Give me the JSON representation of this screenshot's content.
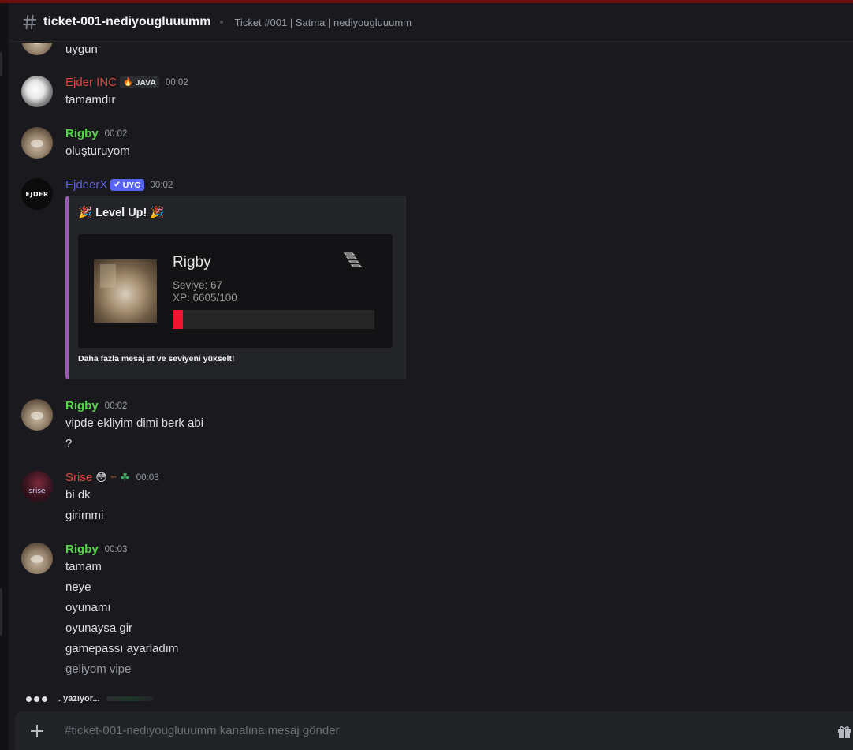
{
  "header": {
    "channel_name": "ticket-001-nediyougluuumm",
    "topic": "Ticket #001 | Satma | nediyougluuumm"
  },
  "messages": [
    {
      "lines": [
        "uygun"
      ]
    },
    {
      "author": "Ejder INC",
      "author_color": "#e0453a",
      "tag": "JAVA",
      "time": "00:02",
      "lines": [
        "tamamdır"
      ]
    },
    {
      "author": "Rigby",
      "author_color": "#55d648",
      "time": "00:02",
      "lines": [
        "oluşturuyom"
      ]
    },
    {
      "author": "EjdeerX",
      "author_color": "#5b63d6",
      "tag": "UYG",
      "avatar_text": "EJDER",
      "time": "00:02",
      "embed": {
        "title": "🎉 Level Up! 🎉",
        "card": {
          "name": "Rigby",
          "level": "Seviye: 67",
          "xp": "XP: 6605/100",
          "progress_fraction": 0.05
        },
        "footer": "Daha fazla mesaj at ve seviyeni yükselt!",
        "accent_color": "#9b59b6"
      }
    },
    {
      "author": "Rigby",
      "author_color": "#55d648",
      "time": "00:02",
      "lines": [
        "vipde ekliyim dimi berk abi",
        "?"
      ]
    },
    {
      "author": "Srise",
      "author_color": "#e0453a",
      "avatar_text": "srise",
      "time": "00:03",
      "lines": [
        "bi dk",
        "girimmi"
      ]
    },
    {
      "author": "Rigby",
      "author_color": "#55d648",
      "time": "00:03",
      "lines": [
        "tamam",
        "neye",
        "oyunamı",
        "oyunaysa gir",
        "gamepassı ayarladım",
        "geliyom vipe"
      ]
    }
  ],
  "typing": {
    "text": ". yazıyor..."
  },
  "composer": {
    "placeholder": "#ticket-001-nediyougluuumm kanalına mesaj gönder"
  },
  "icons": {
    "header": "hash-icon",
    "composer_add": "plus-icon",
    "composer_gift": "gift-icon",
    "embed_card": "stack-icon"
  }
}
